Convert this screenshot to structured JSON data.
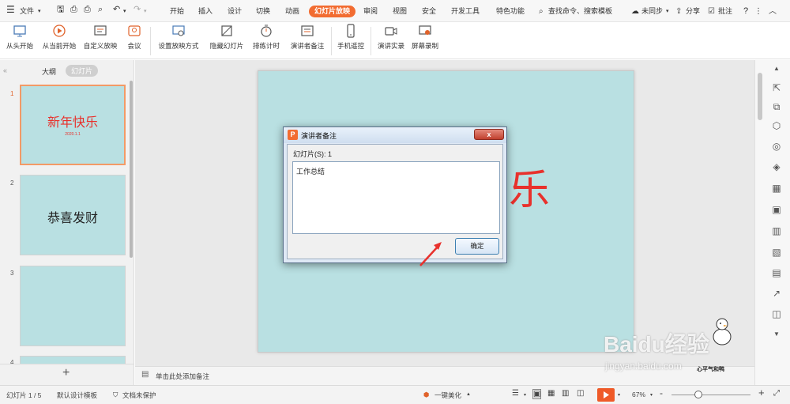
{
  "topbar": {
    "file_menu": "文件",
    "tabs": [
      "开始",
      "插入",
      "设计",
      "切换",
      "动画",
      "幻灯片放映",
      "审阅",
      "视图",
      "安全",
      "开发工具",
      "特色功能"
    ],
    "active_tab_index": 5,
    "search_label": "查找命令、搜索模板",
    "sync_label": "未同步",
    "share_label": "分享",
    "comment_label": "批注",
    "help_label": "?"
  },
  "ribbon": {
    "buttons": [
      "从头开始",
      "从当前开始",
      "自定义放映",
      "会议",
      "设置放映方式",
      "隐藏幻灯片",
      "排练计时",
      "演讲者备注",
      "手机遥控",
      "演讲实录",
      "屏幕录制"
    ]
  },
  "left_panel": {
    "tab_outline": "大纲",
    "tab_slides": "幻灯片",
    "slides": [
      {
        "num": "1",
        "title": "新年快乐",
        "subtitle": "2020.1.1"
      },
      {
        "num": "2",
        "title": "恭喜发财",
        "subtitle": ""
      },
      {
        "num": "3",
        "title": "",
        "subtitle": ""
      },
      {
        "num": "4",
        "title": "",
        "subtitle": ""
      }
    ],
    "add_slide": "+"
  },
  "slide": {
    "visible_char": "乐",
    "title_color": "#e8312c",
    "bg_color": "#b9e0e2"
  },
  "dialog": {
    "title": "演讲者备注",
    "slide_label": "幻灯片(S): 1",
    "note_text": "工作总结",
    "ok_label": "确定",
    "close_label": "x"
  },
  "notes_bar": {
    "placeholder": "单击此处添加备注"
  },
  "status": {
    "slide_count": "幻灯片 1 / 5",
    "template": "默认设计模板",
    "protection": "文档未保护",
    "beautify": "一键美化",
    "zoom": "67%",
    "zoom_minus": "-",
    "zoom_plus": "+"
  },
  "watermark": {
    "brand": "Baidu经验",
    "url": "jingyan.baidu.com",
    "stamp": "心平气和鸭"
  },
  "colors": {
    "accent": "#f26c31",
    "slide_bg": "#b9e0e2"
  }
}
